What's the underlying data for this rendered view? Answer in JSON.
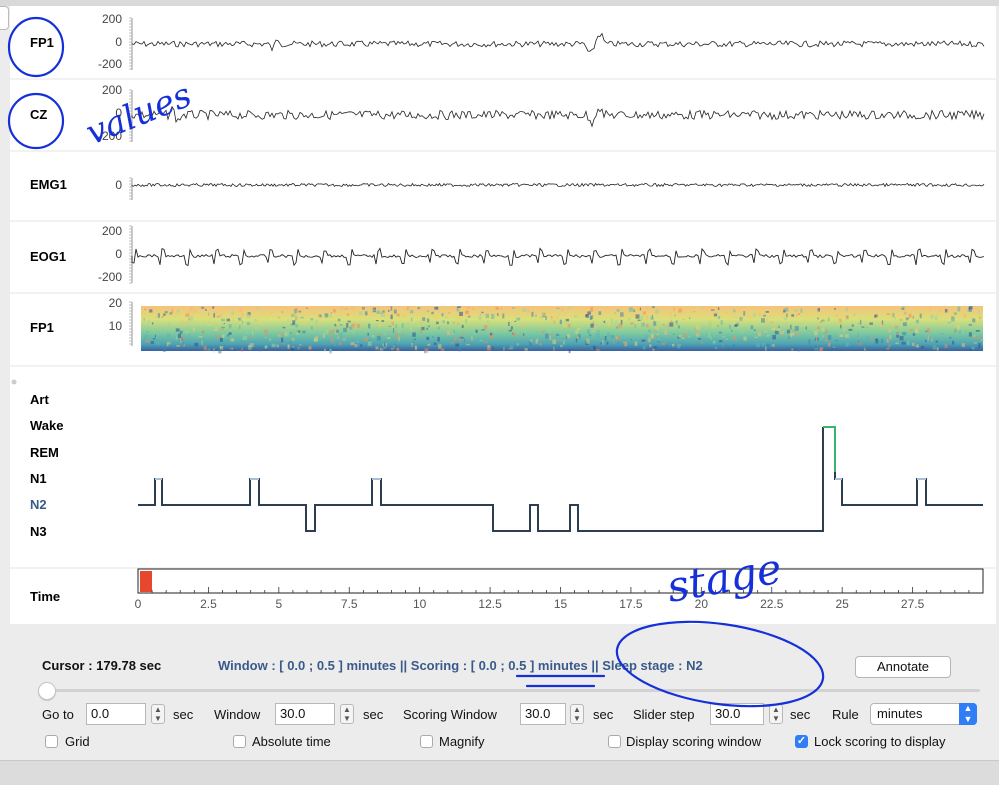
{
  "channels": {
    "fp1": {
      "name": "FP1",
      "ticks": [
        "200",
        "0",
        "-200"
      ]
    },
    "cz": {
      "name": "CZ",
      "ticks": [
        "200",
        "0",
        "-200"
      ]
    },
    "emg1": {
      "name": "EMG1",
      "ticks": [
        "0"
      ]
    },
    "eog1": {
      "name": "EOG1",
      "ticks": [
        "200",
        "0",
        "-200"
      ]
    },
    "spec": {
      "name": "FP1",
      "ticks": [
        "20",
        "10"
      ]
    }
  },
  "hypnogram": {
    "stages": [
      "Art",
      "Wake",
      "REM",
      "N1",
      "N2",
      "N3"
    ],
    "current_stage_color": "#3a5a8a",
    "line_color": "#2c3e50",
    "wake_color": "#3cb371"
  },
  "time_axis": {
    "label": "Time",
    "ticks": [
      "0",
      "2.5",
      "5",
      "7.5",
      "10",
      "12.5",
      "15",
      "17.5",
      "20",
      "22.5",
      "25",
      "27.5"
    ],
    "range": [
      0,
      30
    ],
    "cursor_color": "#e8472f"
  },
  "info": {
    "cursor": "Cursor : 179.78 sec",
    "status": "Window : [ 0.0 ; 0.5 ] minutes || Scoring : [ 0.0 ; 0.5 ] minutes || Sleep stage :   N2",
    "annotate_label": "Annotate"
  },
  "controls": {
    "goto_label": "Go to",
    "goto_value": "0.0",
    "sec1": "sec",
    "window_label": "Window",
    "window_value": "30.0",
    "sec2": "sec",
    "scoring_window_label": "Scoring Window",
    "scoring_window_value": "30.0",
    "sec3": "sec",
    "slider_step_label": "Slider step",
    "slider_step_value": "30.0",
    "sec4": "sec",
    "rule_label": "Rule",
    "rule_value": "minutes"
  },
  "checkboxes": {
    "grid": "Grid",
    "absolute_time": "Absolute time",
    "magnify": "Magnify",
    "display_scoring_window": "Display scoring window",
    "lock_scoring": "Lock scoring to display"
  },
  "handwritten": {
    "values": "values",
    "stage": "stage",
    "color": "#1530d8"
  }
}
